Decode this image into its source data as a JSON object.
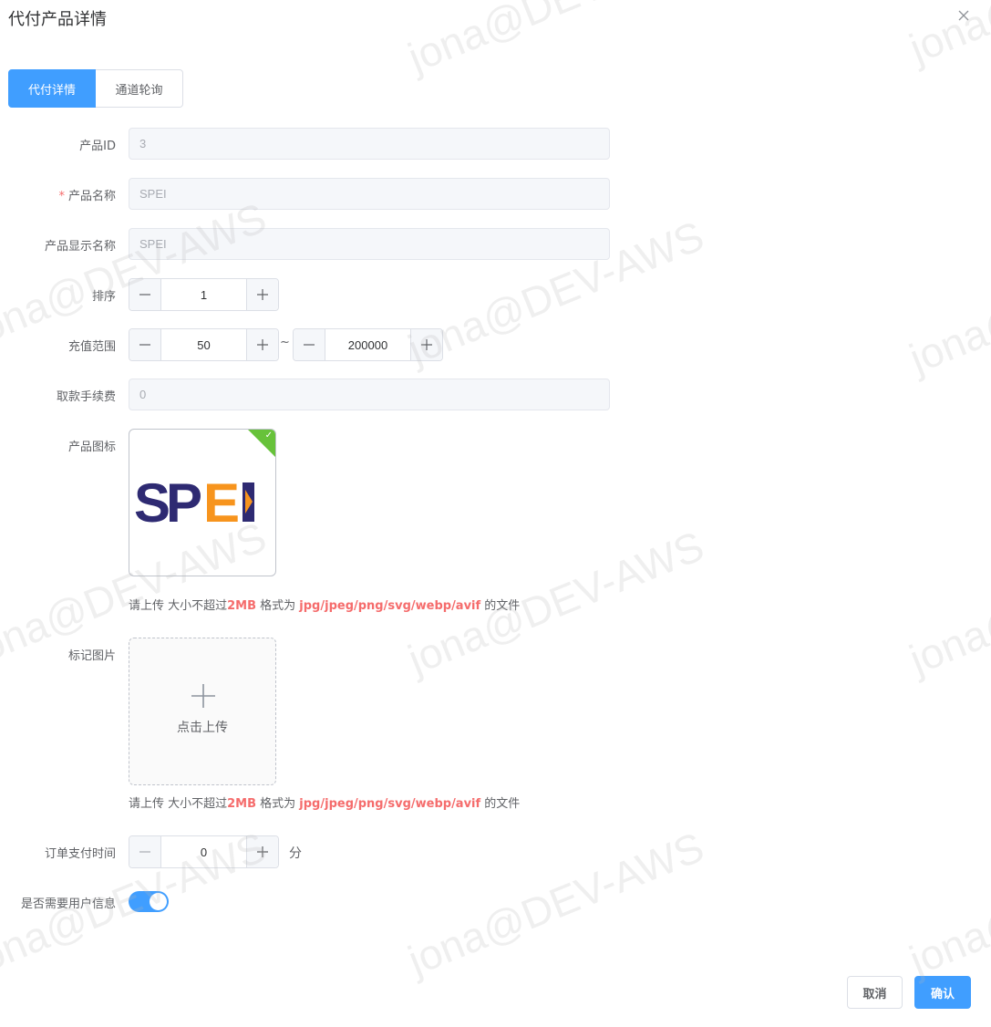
{
  "dialog": {
    "title": "代付产品详情"
  },
  "tabs": [
    {
      "label": "代付详情",
      "active": true
    },
    {
      "label": "通道轮询",
      "active": false
    }
  ],
  "form": {
    "product_id": {
      "label": "产品ID",
      "value": "3"
    },
    "product_name": {
      "label": "产品名称",
      "required_mark": "*",
      "value": "SPEI"
    },
    "display_name": {
      "label": "产品显示名称",
      "value": "SPEI"
    },
    "sort": {
      "label": "排序",
      "value": "1"
    },
    "recharge_range": {
      "label": "充值范围",
      "min": "50",
      "max": "200000",
      "separator": "~"
    },
    "withdraw_fee": {
      "label": "取款手续费",
      "value": "0"
    },
    "product_icon": {
      "label": "产品图标",
      "logo_text": "SPEI",
      "hint": {
        "prefix": "请上传 大小不超过",
        "size": "2MB",
        "middle": " 格式为 ",
        "formats": "jpg/jpeg/png/svg/webp/avif",
        "suffix": " 的文件"
      }
    },
    "mark_image": {
      "label": "标记图片",
      "upload_label": "点击上传",
      "hint": {
        "prefix": "请上传 大小不超过",
        "size": "2MB",
        "middle": " 格式为 ",
        "formats": "jpg/jpeg/png/svg/webp/avif",
        "suffix": " 的文件"
      }
    },
    "payment_time": {
      "label": "订单支付时间",
      "value": "0",
      "unit": "分"
    },
    "need_user_info": {
      "label": "是否需要用户信息",
      "enabled": true
    }
  },
  "footer": {
    "cancel_label": "取消",
    "confirm_label": "确认"
  },
  "watermark": {
    "text": "jona@DEV-AWS"
  },
  "colors": {
    "primary": "#409eff",
    "danger": "#f56c6c",
    "success": "#67c23a",
    "logo_navy": "#2e2a72",
    "logo_orange": "#f7941d"
  }
}
